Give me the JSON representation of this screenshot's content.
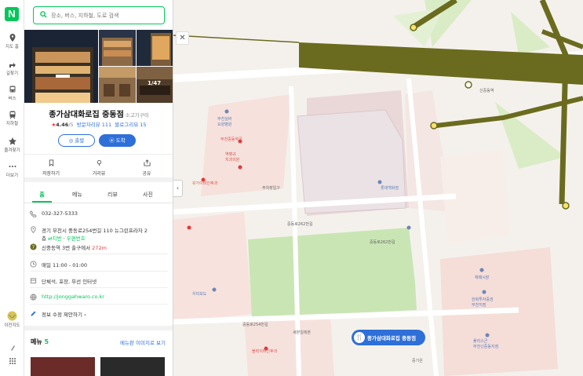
{
  "rail": {
    "logo": "N",
    "items": [
      {
        "icon": "map-pin-icon",
        "label": "지도 홈"
      },
      {
        "icon": "directions-icon",
        "label": "길찾기"
      },
      {
        "icon": "bus-icon",
        "label": "버스"
      },
      {
        "icon": "subway-icon",
        "label": "지하철"
      },
      {
        "icon": "star-icon",
        "label": "즐겨찾기"
      },
      {
        "icon": "more-icon",
        "label": "더보기"
      }
    ],
    "bottom_label": "이전지도"
  },
  "search": {
    "placeholder": "장소, 버스, 지하철, 도로 검색"
  },
  "place": {
    "name": "종가삼대화로집 중동점",
    "category": "소고기구이",
    "photo_counter": "1/47",
    "rating": "4.46",
    "rating_max": "/5",
    "visitor_reviews": "방문자리뷰 111",
    "blog_reviews": "블로그리뷰 15",
    "depart_label": "출발",
    "arrive_label": "도착"
  },
  "actions": [
    {
      "icon": "bookmark-icon",
      "label": "저장하기"
    },
    {
      "icon": "street-view-icon",
      "label": "거리뷰"
    },
    {
      "icon": "share-icon",
      "label": "공유"
    }
  ],
  "tabs": [
    "홈",
    "메뉴",
    "리뷰",
    "사진"
  ],
  "info": {
    "phone": "032-327-5333",
    "address_line1": "경기 부천시 중동로254번길 110 뉴그린프라자 2",
    "address_line2_prefix": "층",
    "address_jibun": "지번",
    "address_postal": "우편번호",
    "subway_prefix": "신중동역 3번 출구에서",
    "subway_distance": "272m",
    "hours": "매일 11:00 - 01:00",
    "services": "단체석, 포장, 무선 인터넷",
    "website": "http://jonggahwaro.co.kr",
    "suggest": "정보 수정 제안하기"
  },
  "menu_section": {
    "title": "메뉴",
    "count": "5",
    "more": "메뉴판 이미지로 보기"
  },
  "map": {
    "marker_label": "종가삼대화로집 중동점",
    "labels": {
      "hospital1": "부천실버\n요양병원",
      "pharmacy": "부천중동약국",
      "clinic": "역병규\n치과의원",
      "ent": "유가이비인후과",
      "lotte": "롯데백화점",
      "parking": "주차장입구",
      "road1": "중동로262번길",
      "road2": "중동로262번길",
      "road3": "중동로254번길",
      "theme": "우미보도",
      "mart": "체매시장",
      "bank": "한화투자증권\n부천지점",
      "nh": "풀리스군\n부천신중동지점",
      "station": "신중동역",
      "hospital2": "블럭이비인후과",
      "seomun": "세븐일레븐",
      "ibk": "중기은"
    }
  }
}
